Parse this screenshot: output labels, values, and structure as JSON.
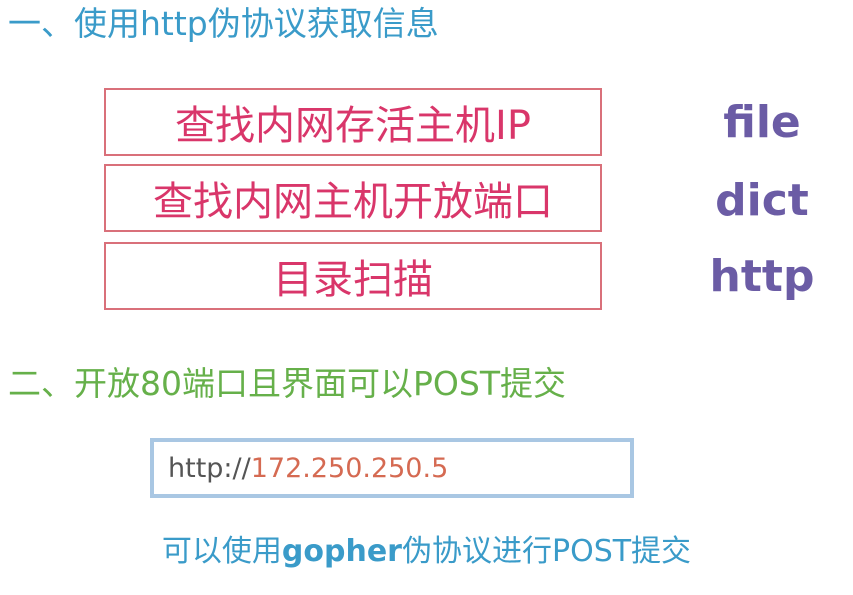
{
  "section1": {
    "heading": "一、使用http伪协议获取信息",
    "rows": [
      {
        "task": "查找内网存活主机IP",
        "protocol": "file"
      },
      {
        "task": "查找内网主机开放端口",
        "protocol": "dict"
      },
      {
        "task": "目录扫描",
        "protocol": "http"
      }
    ]
  },
  "section2": {
    "heading": "二、开放80端口且界面可以POST提交",
    "url": {
      "scheme": "http://",
      "host": "172.250.250.5"
    },
    "note": {
      "prefix": "可以使用",
      "highlight": "gopher",
      "suffix": "伪协议进行POST提交"
    }
  },
  "colors": {
    "heading1": "#3a9bc9",
    "heading2": "#66b04a",
    "box_border": "#d9707a",
    "box_text": "#d9366a",
    "protocol_text": "#6b5ca5",
    "url_border": "#a9c7e3",
    "url_host": "#d56a52",
    "note_text": "#3a9bc9"
  }
}
